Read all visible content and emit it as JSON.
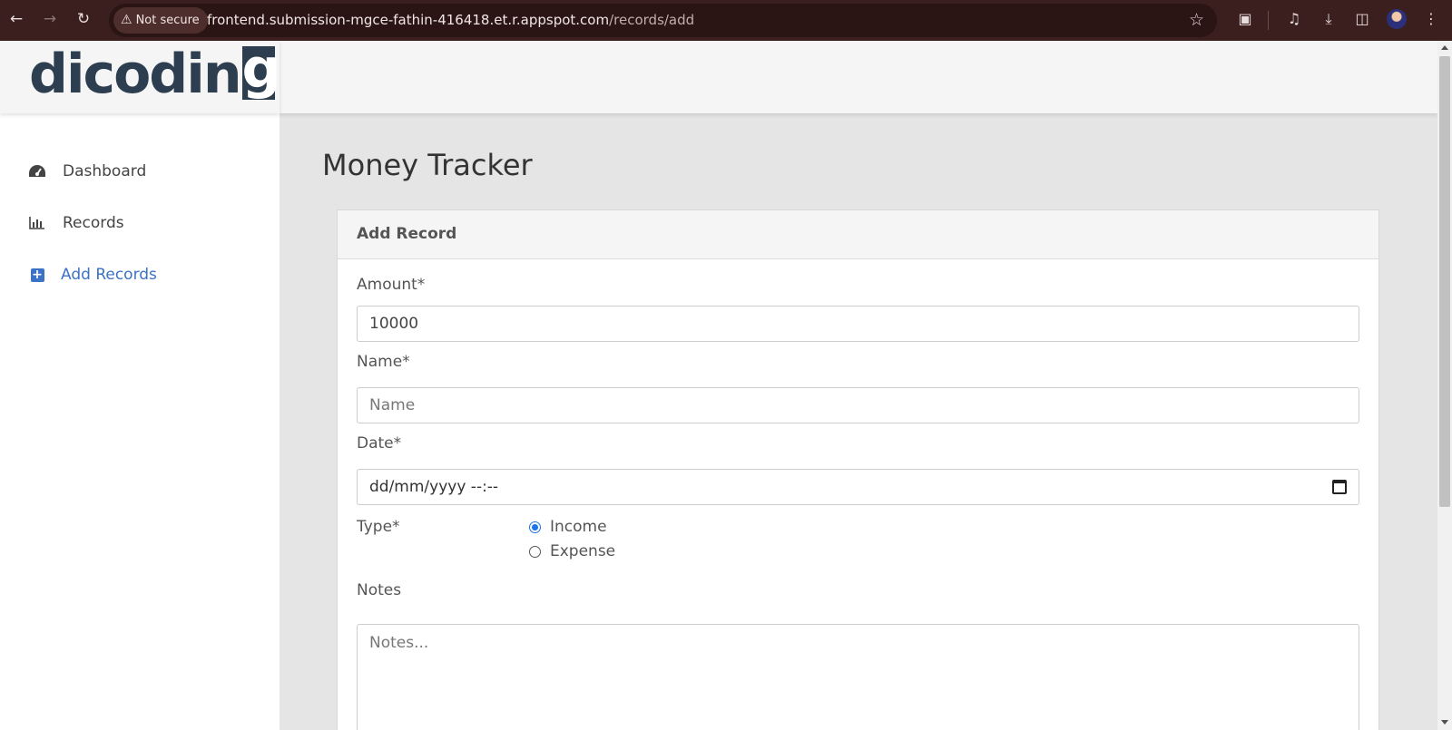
{
  "browser": {
    "security_label": "Not secure",
    "url_host": "frontend.submission-mgce-fathin-416418.et.r.appspot.com",
    "url_path": "/records/add",
    "icons": [
      "back-icon",
      "forward-icon",
      "reload-icon",
      "warning-icon",
      "star-icon",
      "extensions-icon",
      "media-icon",
      "download-icon",
      "sidepanel-icon",
      "profile-avatar",
      "menu-icon"
    ]
  },
  "logo": {
    "text_main": "dicodin",
    "text_boxed": "g"
  },
  "sidebar": {
    "items": [
      {
        "label": "Dashboard",
        "icon": "dashboard-icon",
        "active": false
      },
      {
        "label": "Records",
        "icon": "bar-chart-icon",
        "active": false
      },
      {
        "label": "Add Records",
        "icon": "plus-square-icon",
        "active": true
      }
    ]
  },
  "main": {
    "title": "Money Tracker",
    "card_title": "Add Record",
    "form": {
      "amount_label": "Amount*",
      "amount_value": "10000",
      "name_label": "Name*",
      "name_placeholder": "Name",
      "date_label": "Date*",
      "date_placeholder": "dd/mm/yyyy --:--",
      "type_label": "Type*",
      "type_options": [
        "Income",
        "Expense"
      ],
      "type_selected": "Income",
      "notes_label": "Notes",
      "notes_placeholder": "Notes..."
    }
  },
  "colors": {
    "accent": "#3c72c5",
    "chrome": "#3a1f1e",
    "logo": "#2d3e50"
  }
}
